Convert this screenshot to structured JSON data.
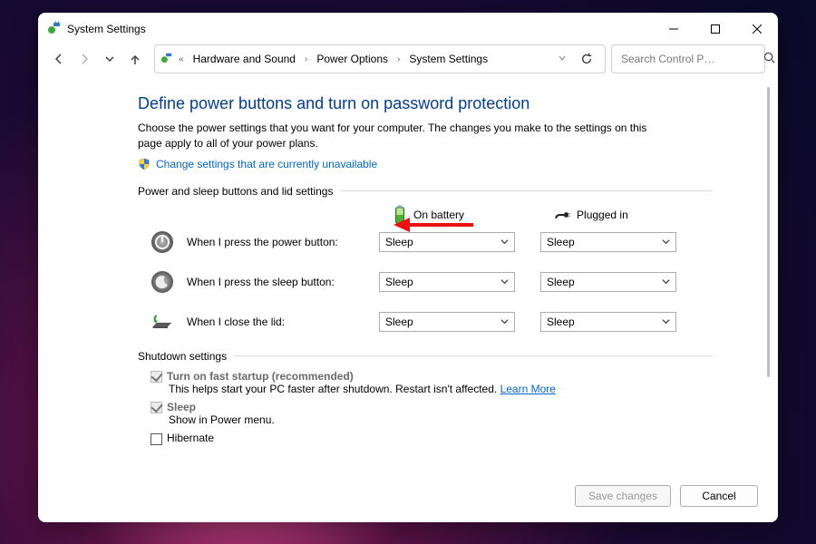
{
  "window": {
    "title": "System Settings"
  },
  "breadcrumb": {
    "items": [
      "Hardware and Sound",
      "Power Options",
      "System Settings"
    ]
  },
  "search": {
    "placeholder": "Search Control P…"
  },
  "page": {
    "heading": "Define power buttons and turn on password protection",
    "description": "Choose the power settings that you want for your computer. The changes you make to the settings on this page apply to all of your power plans.",
    "change_link": "Change settings that are currently unavailable"
  },
  "sections": {
    "power_sleep": "Power and sleep buttons and lid settings",
    "shutdown": "Shutdown settings"
  },
  "columns": {
    "battery": "On battery",
    "plugged": "Plugged in"
  },
  "rows": {
    "power_button": {
      "label": "When I press the power button:",
      "battery": "Sleep",
      "plugged": "Sleep"
    },
    "sleep_button": {
      "label": "When I press the sleep button:",
      "battery": "Sleep",
      "plugged": "Sleep"
    },
    "close_lid": {
      "label": "When I close the lid:",
      "battery": "Sleep",
      "plugged": "Sleep"
    }
  },
  "shutdown": {
    "fast_startup": {
      "label": "Turn on fast startup (recommended)",
      "sub": "This helps start your PC faster after shutdown. Restart isn't affected. ",
      "learn": "Learn More"
    },
    "sleep": {
      "label": "Sleep",
      "sub": "Show in Power menu."
    },
    "hibernate": {
      "label": "Hibernate"
    }
  },
  "footer": {
    "save": "Save changes",
    "cancel": "Cancel"
  }
}
